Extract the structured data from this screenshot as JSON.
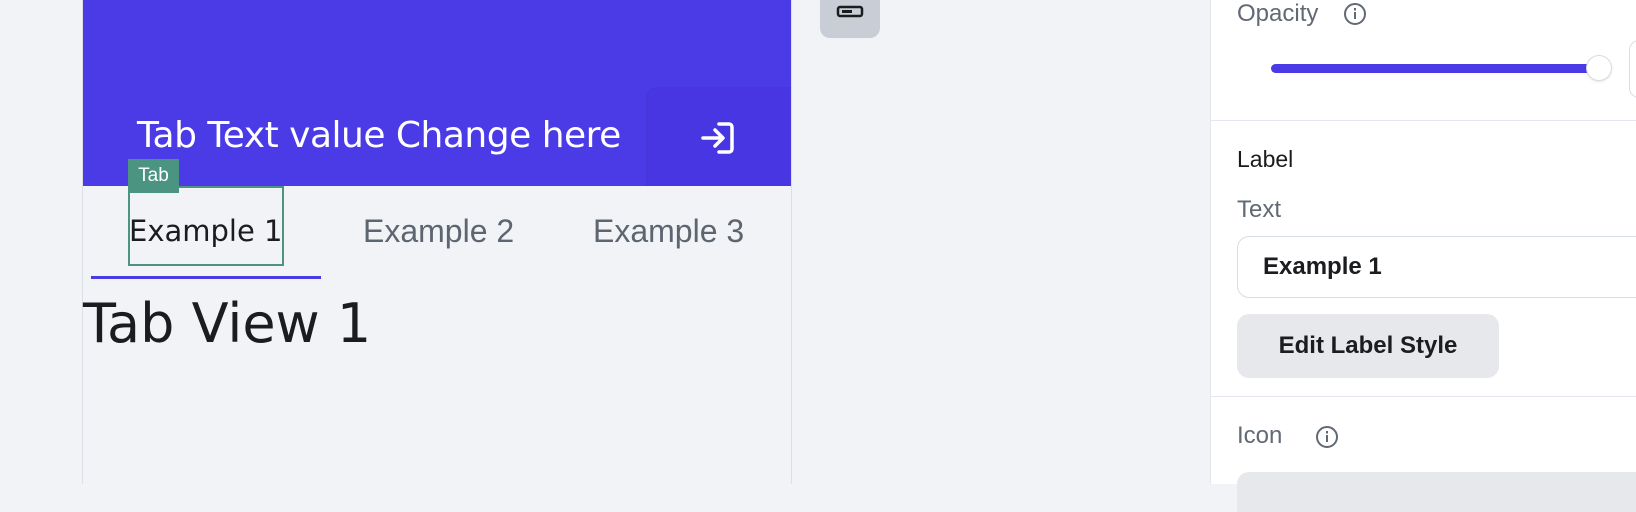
{
  "preview": {
    "appbar_title": "Tab Text value Change here",
    "selection_tag": "Tab",
    "tabs": [
      {
        "label": "Example 1"
      },
      {
        "label": "Example 2"
      },
      {
        "label": "Example 3"
      }
    ],
    "tab_view_title": "Tab View 1"
  },
  "panel": {
    "opacity_label": "Opacity",
    "opacity_value_fraction": 1.0,
    "label_section_title": "Label",
    "text_field_label": "Text",
    "text_field_value": "Example 1",
    "edit_label_style_button": "Edit Label Style",
    "icon_label": "Icon"
  },
  "icons": {
    "appbar_action": "login-arrow-icon",
    "widget_chip": "input-field-icon",
    "info": "info-icon"
  },
  "colors": {
    "primary": "#4a3be6",
    "selection": "#4a9481",
    "page_background": "#f1f3f7"
  }
}
